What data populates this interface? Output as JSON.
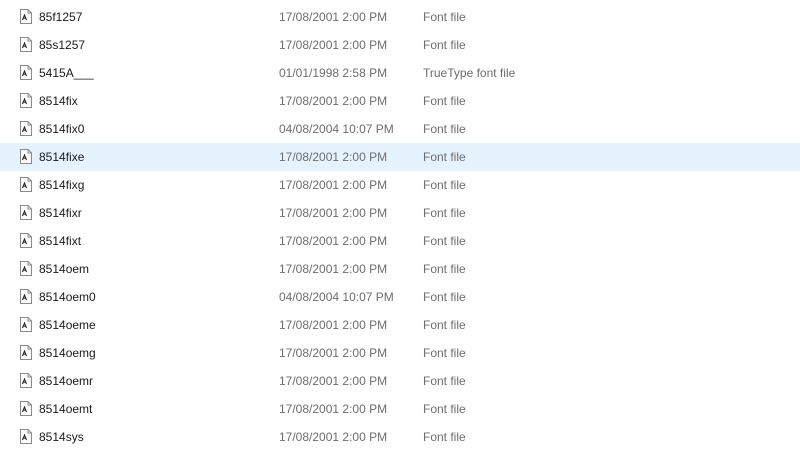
{
  "files": [
    {
      "name": "85f1257",
      "date": "17/08/2001 2:00 PM",
      "type": "Font file",
      "icon": "font-file-icon"
    },
    {
      "name": "85s1257",
      "date": "17/08/2001 2:00 PM",
      "type": "Font file",
      "icon": "font-file-icon"
    },
    {
      "name": "5415A___",
      "date": "01/01/1998 2:58 PM",
      "type": "TrueType font file",
      "icon": "font-file-icon"
    },
    {
      "name": "8514fix",
      "date": "17/08/2001 2:00 PM",
      "type": "Font file",
      "icon": "font-file-icon"
    },
    {
      "name": "8514fix0",
      "date": "04/08/2004 10:07 PM",
      "type": "Font file",
      "icon": "font-file-icon"
    },
    {
      "name": "8514fixe",
      "date": "17/08/2001 2:00 PM",
      "type": "Font file",
      "icon": "font-file-icon",
      "selected": true
    },
    {
      "name": "8514fixg",
      "date": "17/08/2001 2:00 PM",
      "type": "Font file",
      "icon": "font-file-icon"
    },
    {
      "name": "8514fixr",
      "date": "17/08/2001 2:00 PM",
      "type": "Font file",
      "icon": "font-file-icon"
    },
    {
      "name": "8514fixt",
      "date": "17/08/2001 2:00 PM",
      "type": "Font file",
      "icon": "font-file-icon"
    },
    {
      "name": "8514oem",
      "date": "17/08/2001 2:00 PM",
      "type": "Font file",
      "icon": "font-file-icon"
    },
    {
      "name": "8514oem0",
      "date": "04/08/2004 10:07 PM",
      "type": "Font file",
      "icon": "font-file-icon"
    },
    {
      "name": "8514oeme",
      "date": "17/08/2001 2:00 PM",
      "type": "Font file",
      "icon": "font-file-icon"
    },
    {
      "name": "8514oemg",
      "date": "17/08/2001 2:00 PM",
      "type": "Font file",
      "icon": "font-file-icon"
    },
    {
      "name": "8514oemr",
      "date": "17/08/2001 2:00 PM",
      "type": "Font file",
      "icon": "font-file-icon"
    },
    {
      "name": "8514oemt",
      "date": "17/08/2001 2:00 PM",
      "type": "Font file",
      "icon": "font-file-icon"
    },
    {
      "name": "8514sys",
      "date": "17/08/2001 2:00 PM",
      "type": "Font file",
      "icon": "font-file-icon"
    }
  ],
  "colors": {
    "selected_row": "#e5f3ff",
    "secondary_text": "#6d6d6d",
    "primary_text": "#1a1a1a"
  }
}
